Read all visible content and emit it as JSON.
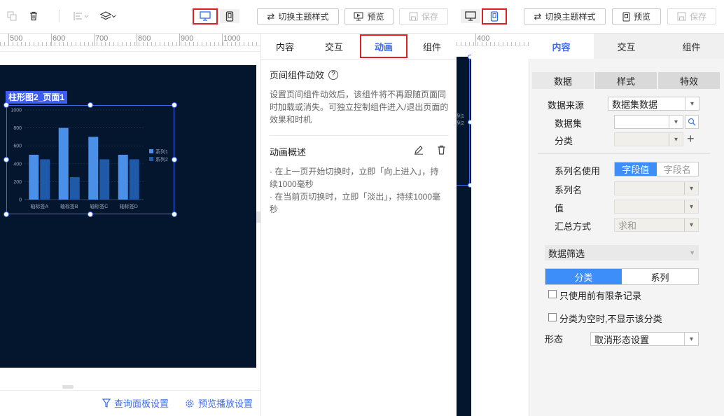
{
  "toolbar_left": {
    "switch_theme_label": "切换主题样式",
    "preview_label": "预览",
    "save_label": "保存"
  },
  "toolbar_right": {
    "switch_theme_label": "切换主题样式",
    "preview_label": "预览",
    "save_label": "保存"
  },
  "ruler_left": [
    "500",
    "600",
    "700",
    "800",
    "900",
    "1000"
  ],
  "ruler_right": [
    "400"
  ],
  "widget": {
    "label": "柱形图2_页面1"
  },
  "chart_data": {
    "type": "bar",
    "categories": [
      "轴标签A",
      "轴标签B",
      "轴标签C",
      "轴标签D"
    ],
    "series": [
      {
        "name": "系列1",
        "values": [
          500,
          800,
          700,
          500
        ],
        "color": "#4a90e8"
      },
      {
        "name": "系列2",
        "values": [
          450,
          250,
          450,
          450
        ],
        "color": "#1f5aa8"
      }
    ],
    "yticks": [
      "0",
      "200",
      "400",
      "600",
      "800",
      "1000"
    ],
    "ylim": [
      0,
      1000
    ],
    "legend": "right"
  },
  "footer": {
    "query_panel": "查询面板设置",
    "playback": "预览播放设置"
  },
  "middle_panel": {
    "tabs": [
      "内容",
      "交互",
      "动画",
      "组件"
    ],
    "active_tab": "动画",
    "section_title": "页间组件动效",
    "description": "设置页间组件动效后，该组件将不再跟随页面同时加载或消失。可独立控制组件进入/退出页面的效果和时机",
    "overview_title": "动画概述",
    "overview_lines": [
      "· 在上一页开始切换时，立即「向上进入」，持续1000毫秒",
      "· 在当前页切换时，立即「淡出」，持续1000毫秒"
    ]
  },
  "right_panel": {
    "tabs": [
      "内容",
      "交互",
      "组件"
    ],
    "subtabs": [
      "数据",
      "样式",
      "特效"
    ],
    "data_source_label": "数据来源",
    "data_source_value": "数据集数据",
    "dataset_label": "数据集",
    "category_label": "分类",
    "series_name_use_label": "系列名使用",
    "toggle_field_value": "字段值",
    "toggle_field_name": "字段名",
    "series_name_label": "系列名",
    "value_label": "值",
    "summary_label": "汇总方式",
    "summary_value": "求和",
    "filter_title": "数据筛选",
    "filter_tabs": [
      "分类",
      "系列"
    ],
    "check_limit": "只使用前有限条记录",
    "check_empty": "分类为空时,不显示该分类",
    "form_label": "形态",
    "form_value": "取消形态设置"
  },
  "colors": {
    "accent": "#3d8ef8",
    "highlight": "#e02020",
    "canvas_bg": "#04152e"
  }
}
